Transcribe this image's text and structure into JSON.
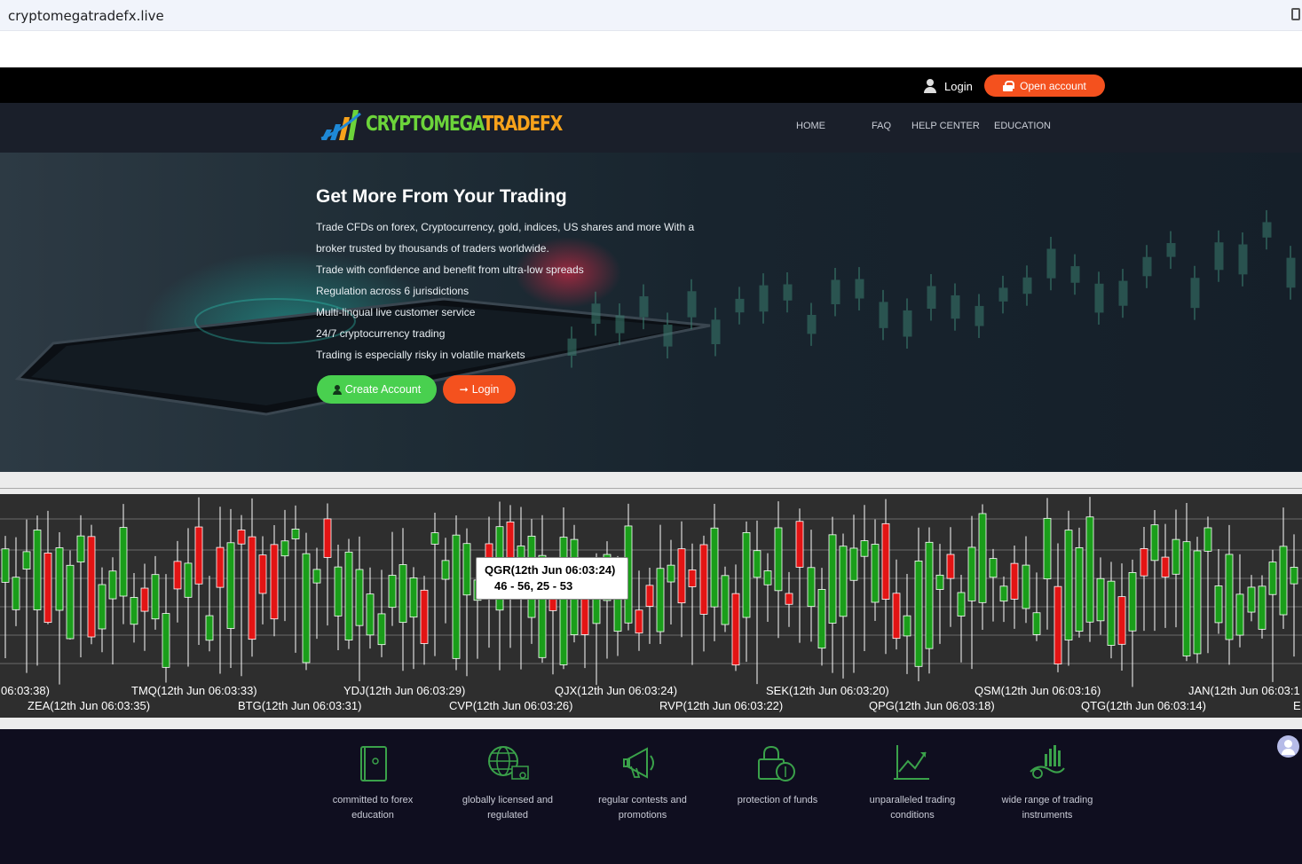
{
  "browser": {
    "url": "cryptomegatradefx.live"
  },
  "topbar": {
    "login_label": "Login",
    "open_account_label": "Open account"
  },
  "brand": {
    "part1": "CRYPTOMEGA",
    "part2": "TRADEFX"
  },
  "nav": {
    "items": [
      {
        "label": "HOME"
      },
      {
        "label": "FAQ"
      },
      {
        "label": "HELP CENTER"
      },
      {
        "label": "EDUCATION"
      }
    ]
  },
  "hero": {
    "title": "Get More From Your Trading",
    "lines": [
      "Trade CFDs on forex, Cryptocurrency, gold, indices, US shares and more With a",
      "broker trusted by thousands of traders worldwide.",
      "Trade with confidence and benefit from ultra-low spreads",
      "Regulation across 6 jurisdictions",
      "Multi-lingual live customer service",
      "24/7 cryptocurrency trading",
      "Trading is especially risky in volatile markets"
    ],
    "create_label": "Create Account",
    "login_label": "Login"
  },
  "chart": {
    "tooltip_title": "QGR(12th Jun 06:03:24)",
    "tooltip_values": "46 - 56, 25 - 53",
    "colors": {
      "up": "#1a9e1a",
      "down": "#e31414",
      "background": "#2e2e2e",
      "grid": "#6a6a6a"
    },
    "ticks_top": [
      "06:03:38)",
      "TMQ(12th Jun 06:03:33)",
      "YDJ(12th Jun 06:03:29)",
      "QJX(12th Jun 06:03:24)",
      "SEK(12th Jun 06:03:20)",
      "QSM(12th Jun 06:03:16)",
      "JAN(12th Jun 06:03:1"
    ],
    "ticks_bottom": [
      "ZEA(12th Jun 06:03:35)",
      "BTG(12th Jun 06:03:31)",
      "CVP(12th Jun 06:03:26)",
      "RVP(12th Jun 06:03:22)",
      "QPG(12th Jun 06:03:18)",
      "QTG(12th Jun 06:03:14)",
      "E"
    ]
  },
  "features": [
    {
      "label1": "committed to forex",
      "label2": "education",
      "icon": "book-icon"
    },
    {
      "label1": "globally licensed and",
      "label2": "regulated",
      "icon": "globe-certificate-icon"
    },
    {
      "label1": "regular contests and",
      "label2": "promotions",
      "icon": "megaphone-icon"
    },
    {
      "label1": "protection of funds",
      "label2": "",
      "icon": "lock-money-icon"
    },
    {
      "label1": "unparalleled trading",
      "label2": "conditions",
      "icon": "chart-trend-icon"
    },
    {
      "label1": "wide range of trading",
      "label2": "instruments",
      "icon": "instruments-icon"
    }
  ]
}
